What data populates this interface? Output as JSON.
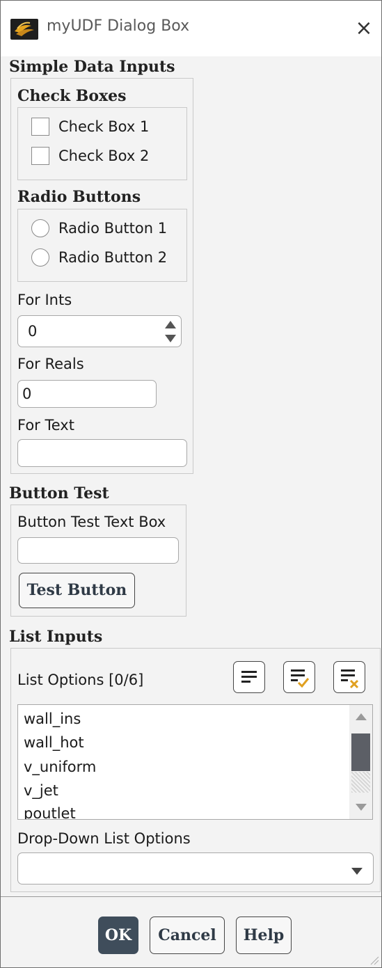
{
  "window": {
    "title": "myUDF Dialog Box",
    "close_glyph": "×",
    "icon": "fluent-app-icon"
  },
  "simple": {
    "title": "Simple Data Inputs",
    "checkboxes": {
      "title": "Check Boxes",
      "items": [
        {
          "label": "Check Box 1",
          "checked": false
        },
        {
          "label": "Check Box 2",
          "checked": false
        }
      ]
    },
    "radios": {
      "title": "Radio Buttons",
      "items": [
        {
          "label": "Radio Button 1",
          "selected": false
        },
        {
          "label": "Radio Button 2",
          "selected": false
        }
      ]
    },
    "ints": {
      "label": "For Ints",
      "value": "0"
    },
    "reals": {
      "label": "For Reals",
      "value": "0"
    },
    "text": {
      "label": "For Text",
      "value": ""
    }
  },
  "button_test": {
    "title": "Button Test",
    "textbox_label": "Button Test Text Box",
    "textbox_value": "",
    "button_label": "Test Button"
  },
  "list_inputs": {
    "title": "List Inputs",
    "list_label": "List Options",
    "count": "[0/6]",
    "items": [
      "wall_ins",
      "wall_hot",
      "v_uniform",
      "v_jet",
      "poutlet"
    ],
    "dropdown_label": "Drop-Down List Options",
    "dropdown_value": ""
  },
  "footer": {
    "ok_label": "OK",
    "cancel_label": "Cancel",
    "help_label": "Help"
  },
  "colors": {
    "ok_bg": "#3f4d5b",
    "dark_text": "#2f3a46",
    "accent": "#e0a020"
  }
}
